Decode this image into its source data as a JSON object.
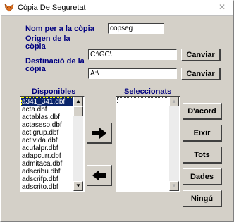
{
  "window": {
    "title": "Còpia De Seguretat",
    "close_glyph": "✕"
  },
  "form": {
    "name_label": "Nom per a la còpia",
    "name_value": "copseg",
    "origin_label_line1": "Origen de la",
    "origin_label_line2": "còpia",
    "origin_value": "C:\\GC\\",
    "dest_label_line1": "Destinació de la",
    "dest_label_line2": "còpia",
    "dest_value": "A:\\",
    "change_origin": "Canviar",
    "change_dest": "Canviar"
  },
  "available": {
    "header": "Disponibles",
    "items": [
      "a341_341.dbf",
      "acta.dbf",
      "actablas.dbf",
      "actaseso.dbf",
      "actigrup.dbf",
      "activida.dbf",
      "acufalpr.dbf",
      "adapcurr.dbf",
      "admitaca.dbf",
      "adscribu.dbf",
      "adscrifp.dbf",
      "adscrito.dbf"
    ],
    "selected_index": 0
  },
  "selected": {
    "header": "Seleccionats",
    "items": []
  },
  "actions": {
    "accept": "D'acord",
    "exit": "Eixir",
    "all": "Tots",
    "data": "Dades",
    "none": "Ningú"
  },
  "icons": {
    "add_arrow": "right-arrow-icon",
    "remove_arrow": "left-arrow-icon",
    "app": "fox-icon"
  },
  "colors": {
    "label": "#000080",
    "selection": "#0a246a",
    "face": "#d4d0c8",
    "app_icon": "#e07020"
  }
}
